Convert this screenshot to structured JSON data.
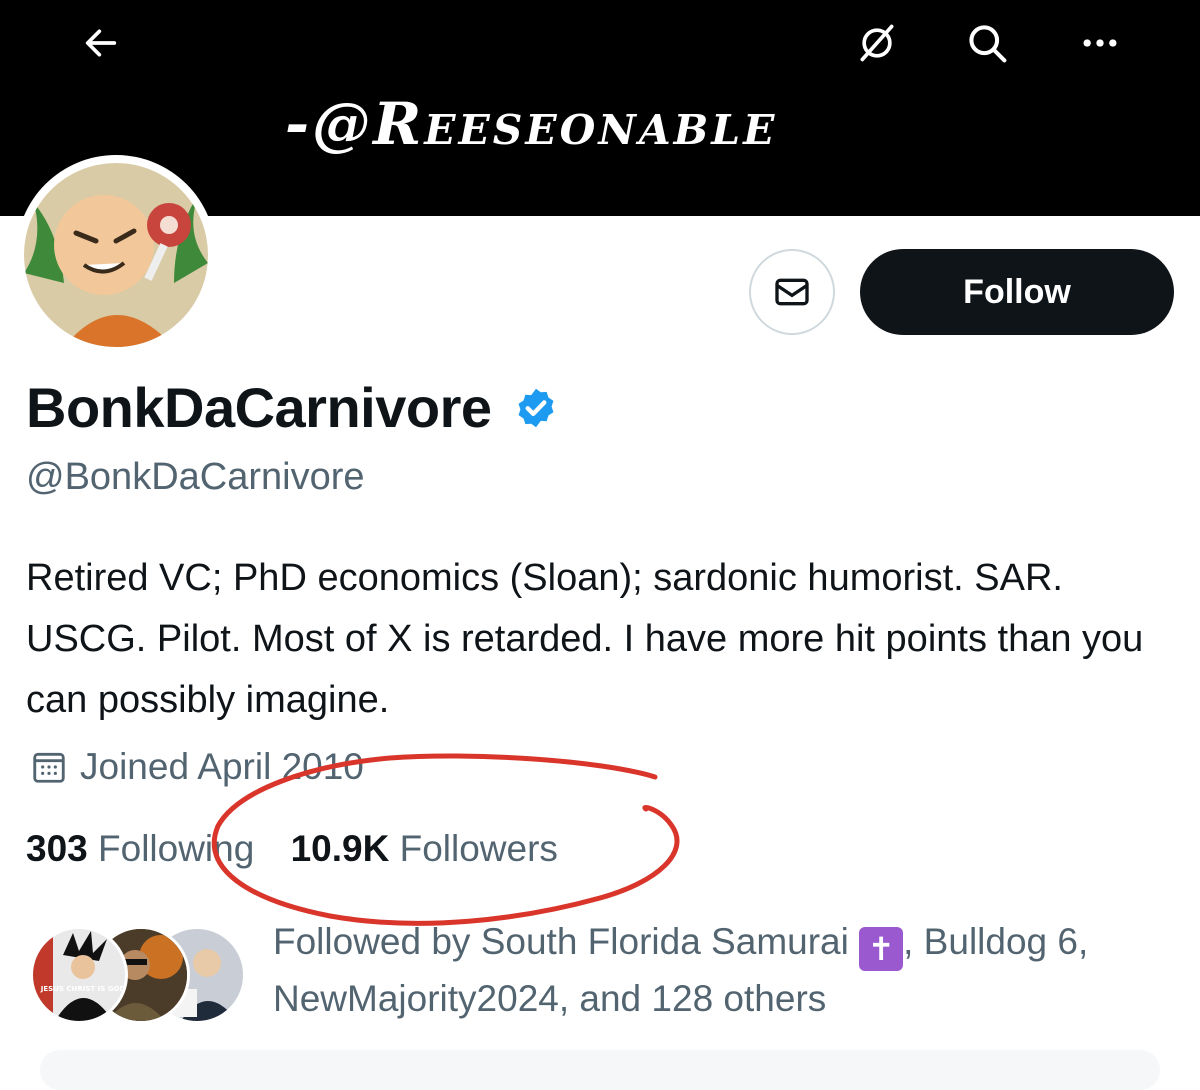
{
  "banner": {
    "text": "-@Reeseonable",
    "back_icon": "back-arrow-icon",
    "translate_icon": "no-translate-icon",
    "search_icon": "search-icon",
    "more_icon": "more-icon"
  },
  "actions": {
    "follow_label": "Follow",
    "message_icon": "mail-icon"
  },
  "profile": {
    "display_name": "BonkDaCarnivore",
    "handle": "@BonkDaCarnivore",
    "verified": true,
    "bio": "Retired VC; PhD economics (Sloan); sardonic humorist. SAR. USCG. Pilot. Most of X is retarded. I have more hit points than you can possibly imagine.",
    "joined": "Joined April 2010"
  },
  "stats": {
    "following_count": "303",
    "following_label": "Following",
    "followers_count": "10.9K",
    "followers_label": "Followers"
  },
  "followed_by": {
    "prefix": "Followed by South Florida Samurai",
    "emoji": "✝",
    "suffix": ", Bulldog 6, NewMajority2024, and 128 others",
    "avatar1_text": "JESUS CHRIST IS GOD"
  },
  "colors": {
    "accent": "#1d9bf0",
    "text": "#0f1419",
    "muted": "#536471",
    "annotation": "#d9352b"
  }
}
